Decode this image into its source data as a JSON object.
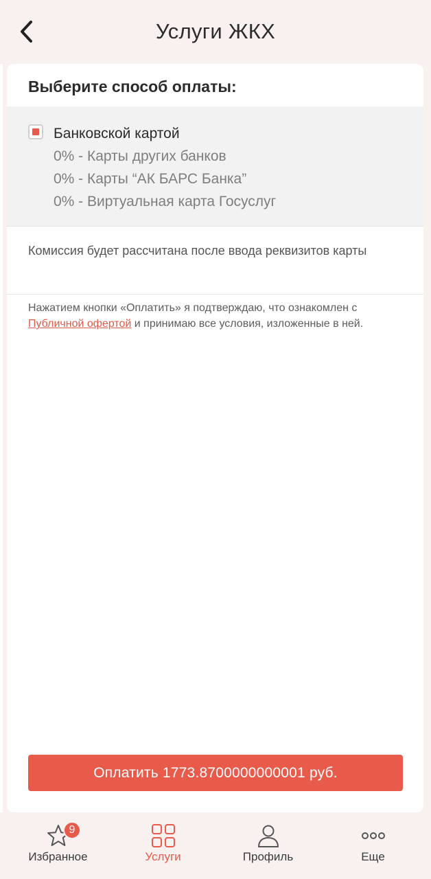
{
  "header": {
    "title": "Услуги ЖКХ"
  },
  "payment": {
    "heading": "Выберите способ оплаты:",
    "method": {
      "title": "Банковской картой",
      "lines": [
        "0% - Карты других банков",
        "0% - Карты “АК БАРС Банка”",
        "0% - Виртуальная карта Госуслуг"
      ]
    },
    "commission": "Комиссия будет рассчитана после ввода реквизитов карты",
    "offer": {
      "before": "Нажатием кнопки «Оплатить» я подтверждаю, что ознакомлен с ",
      "link": "Публичной офертой",
      "after": " и принимаю все условия, изложенные в ней."
    },
    "pay_button": "Оплатить 1773.8700000000001 руб."
  },
  "tabbar": {
    "items": [
      {
        "label": "Избранное",
        "icon": "star-icon",
        "badge": "9"
      },
      {
        "label": "Услуги",
        "icon": "grid-icon"
      },
      {
        "label": "Профиль",
        "icon": "user-icon"
      },
      {
        "label": "Еще",
        "icon": "more-icon"
      }
    ]
  },
  "colors": {
    "accent": "#e85a4a",
    "background": "#f8f1f0"
  }
}
